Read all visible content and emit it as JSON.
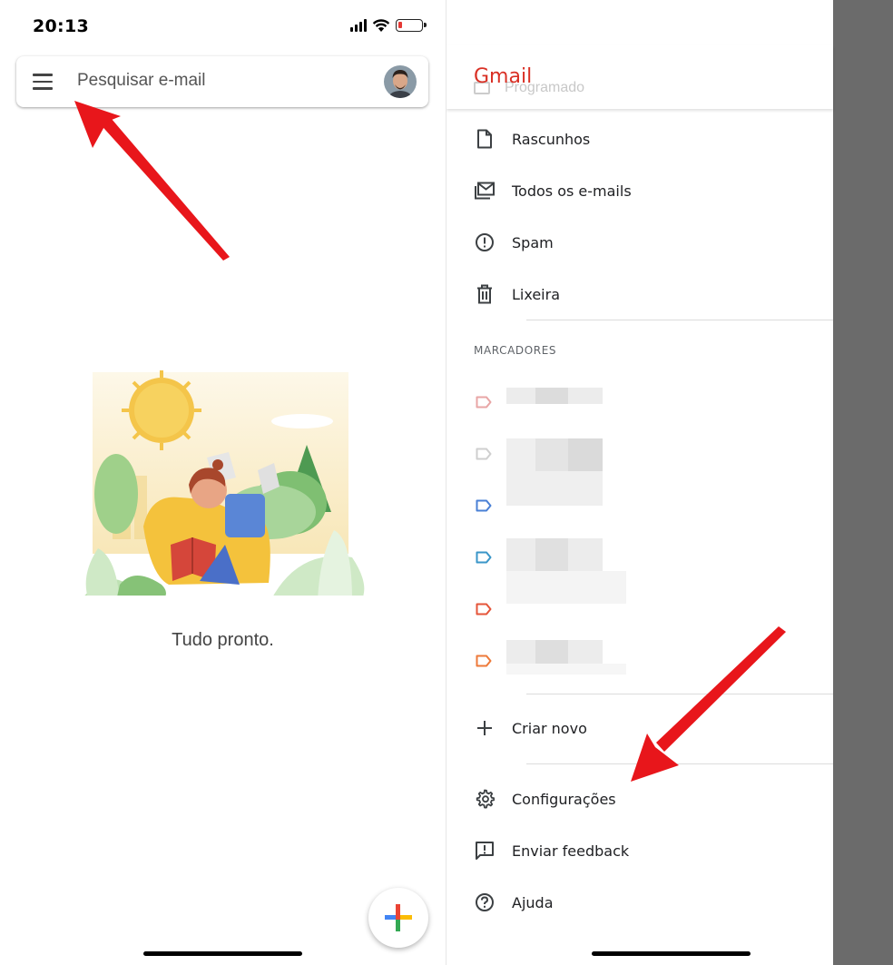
{
  "left": {
    "status_time": "20:13",
    "search_placeholder": "Pesquisar e-mail",
    "empty_message": "Tudo pronto."
  },
  "right": {
    "logo": "Gmail",
    "ghost_item": "Programado",
    "items": [
      {
        "label": "Rascunhos",
        "icon": "draft-icon"
      },
      {
        "label": "Todos os e-mails",
        "icon": "all-mail-icon"
      },
      {
        "label": "Spam",
        "icon": "spam-icon"
      },
      {
        "label": "Lixeira",
        "icon": "trash-icon"
      }
    ],
    "labels_section": "MARCADORES",
    "label_colors": [
      "#e8a6a6",
      "#cfcfcf",
      "#4a80d6",
      "#3a96c8",
      "#e5553a",
      "#ee7a3a"
    ],
    "bottom_items": [
      {
        "label": "Criar novo",
        "icon": "plus-icon"
      },
      {
        "label": "Configurações",
        "icon": "gear-icon"
      },
      {
        "label": "Enviar feedback",
        "icon": "feedback-icon"
      },
      {
        "label": "Ajuda",
        "icon": "help-icon"
      }
    ]
  },
  "colors": {
    "gmail_red": "#d93025",
    "annotation_arrow": "#e8161b",
    "scrim": "#6b6b6b"
  }
}
